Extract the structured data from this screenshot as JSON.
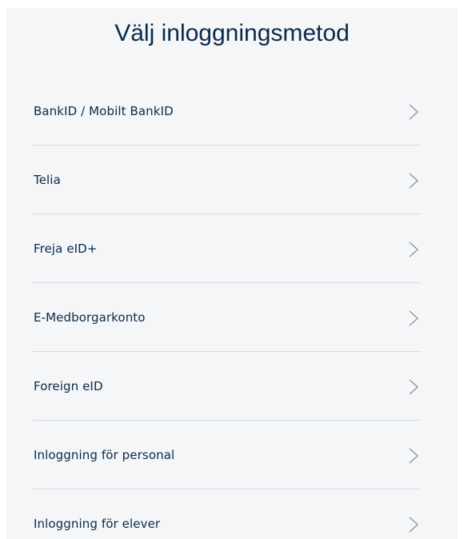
{
  "header": {
    "title": "Välj inloggningsmetod"
  },
  "methods": [
    {
      "label": "BankID / Mobilt BankID",
      "icon": "chevron-right-icon"
    },
    {
      "label": "Telia",
      "icon": "chevron-right-icon"
    },
    {
      "label": "Freja eID+",
      "icon": "chevron-right-icon"
    },
    {
      "label": "E-Medborgarkonto",
      "icon": "chevron-right-icon"
    },
    {
      "label": "Foreign eID",
      "icon": "chevron-right-icon"
    },
    {
      "label": "Inloggning för personal",
      "icon": "chevron-right-icon"
    },
    {
      "label": "Inloggning för elever",
      "icon": "chevron-right-icon"
    }
  ],
  "colors": {
    "text": "#0a2a4a",
    "panel_background": "#f4f6f8",
    "divider": "#b9c0c8",
    "chevron": "#8a939c"
  }
}
